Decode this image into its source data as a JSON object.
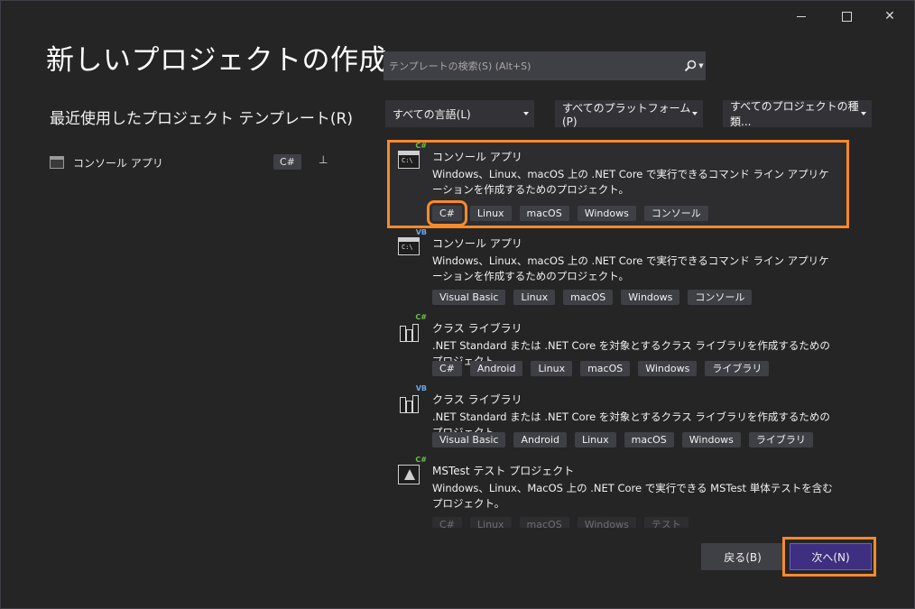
{
  "window": {
    "title": "新しいプロジェクトの作成",
    "controls": {
      "minimize": "—",
      "maximize": "☐",
      "close": "✕"
    }
  },
  "recent": {
    "heading": "最近使用したプロジェクト テンプレート(R)",
    "items": [
      {
        "name": "コンソール アプリ",
        "lang": "C#",
        "pin": "⊥"
      }
    ]
  },
  "search": {
    "placeholder": "テンプレートの検索(S) (Alt+S)",
    "value": "",
    "icon": "search-icon"
  },
  "filters": {
    "language": "すべての言語(L)",
    "platform": "すべてのプラットフォーム(P)",
    "project_type": "すべてのプロジェクトの種類..."
  },
  "templates": [
    {
      "name": "コンソール アプリ",
      "lang_badge": "C#",
      "description": "Windows、Linux、macOS 上の .NET Core で実行できるコマンド ライン アプリケーションを作成するためのプロジェクト。",
      "tags": [
        "C#",
        "Linux",
        "macOS",
        "Windows",
        "コンソール"
      ],
      "selected": true
    },
    {
      "name": "コンソール アプリ",
      "lang_badge": "VB",
      "description": "Windows、Linux、macOS 上の .NET Core で実行できるコマンド ライン アプリケーションを作成するためのプロジェクト。",
      "tags": [
        "Visual Basic",
        "Linux",
        "macOS",
        "Windows",
        "コンソール"
      ]
    },
    {
      "name": "クラス ライブラリ",
      "lang_badge": "C#",
      "description": ".NET Standard または .NET Core を対象とするクラス ライブラリを作成するためのプロジェクト",
      "tags": [
        "C#",
        "Android",
        "Linux",
        "macOS",
        "Windows",
        "ライブラリ"
      ]
    },
    {
      "name": "クラス ライブラリ",
      "lang_badge": "VB",
      "description": ".NET Standard または .NET Core を対象とするクラス ライブラリを作成するためのプロジェクト",
      "tags": [
        "Visual Basic",
        "Android",
        "Linux",
        "macOS",
        "Windows",
        "ライブラリ"
      ]
    },
    {
      "name": "MSTest テスト プロジェクト",
      "lang_badge": "C#",
      "description": "Windows、Linux、MacOS 上の .NET Core で実行できる MSTest 単体テストを含むプロジェクト。",
      "tags": [
        "C#",
        "Linux",
        "macOS",
        "Windows",
        "テスト"
      ]
    }
  ],
  "buttons": {
    "back": "戻る(B)",
    "next": "次へ(N)"
  },
  "colors": {
    "background": "#252526",
    "highlight": "#f78a2a",
    "primary_button": "#3e2f80",
    "tag_bg": "#3f3f46"
  }
}
